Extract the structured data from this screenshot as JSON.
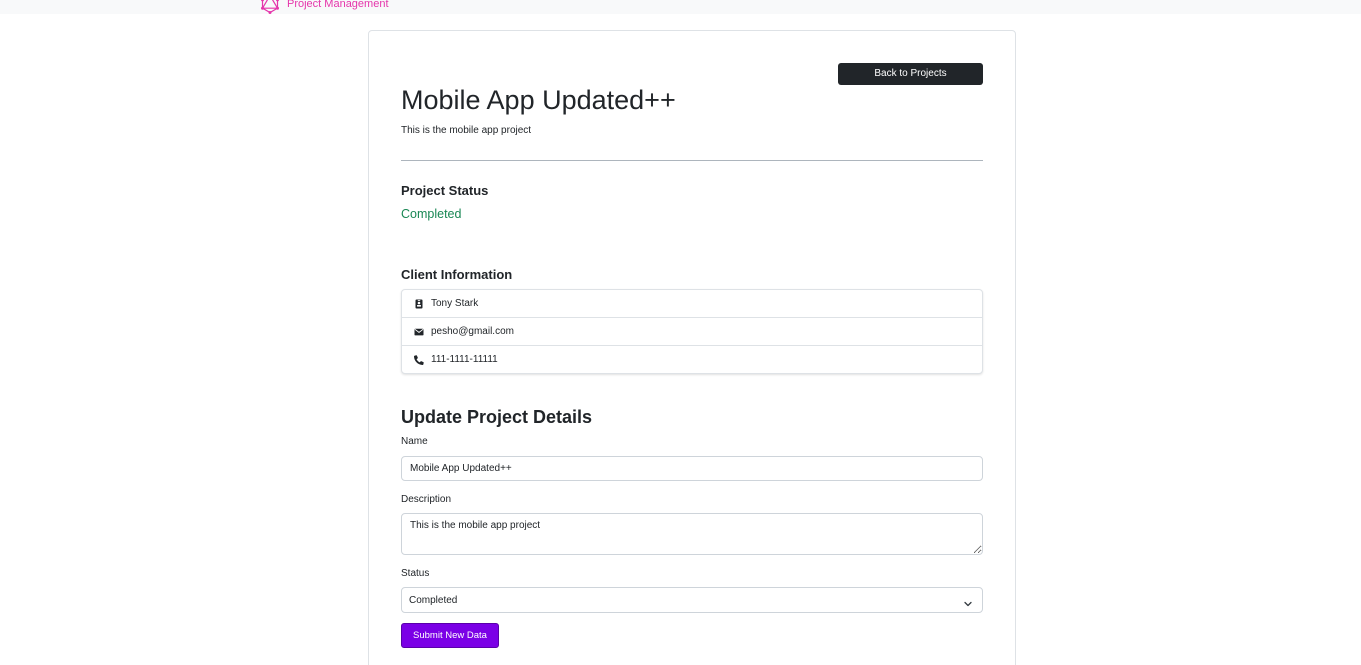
{
  "navbar": {
    "brand_icon": "graphql-logo-icon",
    "brand_text": "Project Management",
    "brand_color": "#e535ab"
  },
  "project": {
    "back_button_label": "Back to Projects",
    "title": "Mobile App Updated++",
    "description": "This is the mobile app project",
    "status_heading": "Project Status",
    "status_value": "Completed",
    "status_color": "#198754"
  },
  "client": {
    "heading": "Client Information",
    "items": [
      {
        "icon": "id-badge-icon",
        "text": "Tony Stark"
      },
      {
        "icon": "envelope-icon",
        "text": "pesho@gmail.com"
      },
      {
        "icon": "phone-icon",
        "text": "111-1111-11111"
      }
    ]
  },
  "form": {
    "heading": "Update Project Details",
    "name_label": "Name",
    "name_value": "Mobile App Updated++",
    "description_label": "Description",
    "description_value": "This is the mobile app project",
    "status_label": "Status",
    "status_value": "Completed",
    "submit_label": "Submit New Data",
    "submit_color": "#7b00e6"
  }
}
